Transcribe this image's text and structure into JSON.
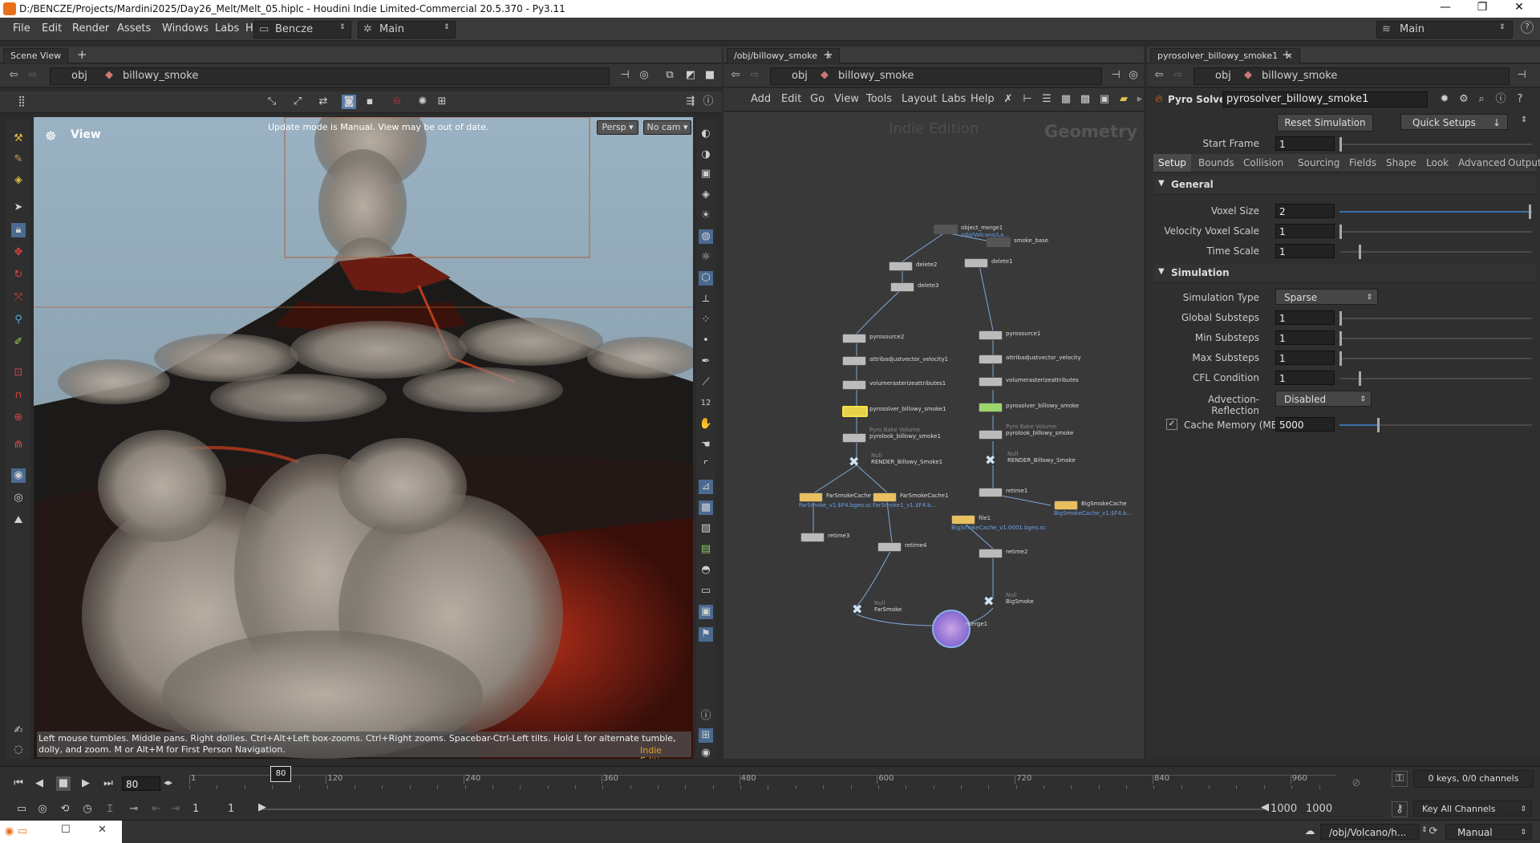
{
  "window": {
    "title": "D:/BENCZE/Projects/Mardini2025/Day26_Melt/Melt_05.hiplc - Houdini Indie Limited-Commercial 20.5.370 - Py3.11"
  },
  "menubar": {
    "items": [
      "File",
      "Edit",
      "Render",
      "Assets",
      "Windows",
      "Labs",
      "Help"
    ],
    "desktop": "Bencze",
    "shelfset": "Main",
    "right_desk": "Main"
  },
  "scene_view": {
    "tab": "Scene View",
    "path_root": "obj",
    "path_node": "billowy_smoke",
    "view_label": "View",
    "notice": "Update mode is Manual. View may be out of date.",
    "camera_mode": "Persp",
    "camera": "No cam",
    "hint": "Left mouse tumbles. Middle pans. Right dollies. Ctrl+Alt+Left box-zooms. Ctrl+Right zooms. Spacebar-Ctrl-Left tilts. Hold L for alternate tumble, dolly, and zoom. M or Alt+M for First Person Navigation.",
    "edition": "Indie Edition"
  },
  "network": {
    "tab": "/obj/billowy_smoke",
    "path_root": "obj",
    "path_node": "billowy_smoke",
    "menu": [
      "Add",
      "Edit",
      "Go",
      "View",
      "Tools",
      "Layout",
      "Labs",
      "Help"
    ],
    "watermark": "Indie Edition",
    "context": "Geometry",
    "nodes": [
      {
        "name": "object_merge1",
        "sub": "/obj/Volcano/La..."
      },
      {
        "name": "smoke_base"
      },
      {
        "name": "delete2"
      },
      {
        "name": "delete1"
      },
      {
        "name": "delete3"
      },
      {
        "name": "pyrosource2"
      },
      {
        "name": "pyrosource1"
      },
      {
        "name": "attribadjustvector_velocity1"
      },
      {
        "name": "attribadjustvector_velocity"
      },
      {
        "name": "volumerasterizeattributes1"
      },
      {
        "name": "volumerasterizeattributes"
      },
      {
        "name": "pyrosolver_billowy_smoke1"
      },
      {
        "name": "pyrosolver_billowy_smoke"
      },
      {
        "name": "pyrolook_billowy_smoke1",
        "sub": "Pyro Bake Volume"
      },
      {
        "name": "pyrolook_billowy_smoke",
        "sub": "Pyro Bake Volume"
      },
      {
        "name": "RENDER_Billowy_Smoke1",
        "sub": "Null"
      },
      {
        "name": "RENDER_Billowy_Smoke",
        "sub": "Null"
      },
      {
        "name": "FarSmokeCache",
        "sub": "FarSmoke_v1.$F4.bgeo.sc"
      },
      {
        "name": "FarSmokeCache1",
        "sub": "FarSmoke1_v1.$F4.b..."
      },
      {
        "name": "retime1"
      },
      {
        "name": "BigSmokeCache",
        "sub": "BigSmokeCache_v1.$F4.b..."
      },
      {
        "name": "file1",
        "sub": "BigSmokeCache_v1.0001.bgeo.sc"
      },
      {
        "name": "retime3"
      },
      {
        "name": "retime4"
      },
      {
        "name": "retime2"
      },
      {
        "name": "FarSmoke",
        "sub": "Null"
      },
      {
        "name": "BigSmoke",
        "sub": "Null"
      },
      {
        "name": "merge1"
      }
    ]
  },
  "params": {
    "tab": "pyrosolver_billowy_smoke1",
    "path_root": "obj",
    "path_node": "billowy_smoke",
    "node_type": "Pyro Solver",
    "node_name": "pyrosolver_billowy_smoke1",
    "reset_button": "Reset Simulation",
    "quick_setups": "Quick Setups",
    "start_frame_label": "Start Frame",
    "start_frame": "1",
    "tabs": [
      "Setup",
      "Bounds",
      "Collision",
      "Sourcing",
      "Fields",
      "Shape",
      "Look",
      "Advanced",
      "Output"
    ],
    "general_header": "General",
    "general": [
      {
        "label": "Voxel Size",
        "value": "2",
        "level": 1.0
      },
      {
        "label": "Velocity Voxel Scale",
        "value": "1",
        "level": 0.0
      },
      {
        "label": "Time Scale",
        "value": "1",
        "level": 0.1
      }
    ],
    "simulation_header": "Simulation",
    "sim_type_label": "Simulation Type",
    "sim_type": "Sparse",
    "simulation": [
      {
        "label": "Global Substeps",
        "value": "1",
        "level": 0.0
      },
      {
        "label": "Min Substeps",
        "value": "1",
        "level": 0.0
      },
      {
        "label": "Max Substeps",
        "value": "1",
        "level": 0.0
      },
      {
        "label": "CFL Condition",
        "value": "1",
        "level": 0.1
      }
    ],
    "advection_label": "Advection-Reflection",
    "advection": "Disabled",
    "cache_label": "Cache Memory (MB)",
    "cache_value": "5000",
    "cache_level": 0.2
  },
  "timeline": {
    "current_frame": "80",
    "frame_marker": "80",
    "ticks": [
      "1",
      "120",
      "240",
      "360",
      "480",
      "600",
      "720",
      "840",
      "960"
    ],
    "range_start": "1",
    "range_start2": "1",
    "range_end": "1000",
    "range_end2": "1000",
    "keys_info": "0 keys, 0/0 channels",
    "key_all": "Key All Channels"
  },
  "statusbar": {
    "path": "/obj/Volcano/h...",
    "update_mode": "Manual"
  }
}
